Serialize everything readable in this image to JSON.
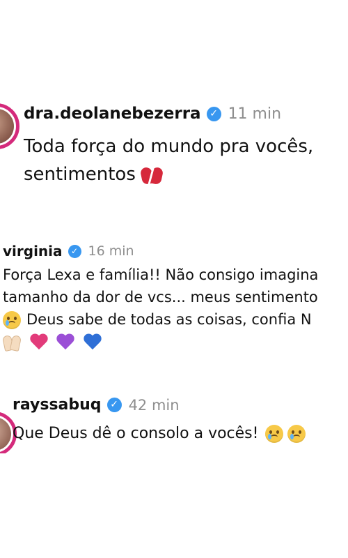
{
  "comments": [
    {
      "username": "dra.deolanebezerra",
      "time": "11 min",
      "line1": "Toda força do mundo pra vocês,",
      "line2": "sentimentos",
      "line2_emoji": [
        "broken-heart-icon"
      ]
    },
    {
      "username": "virginia",
      "time": "16 min",
      "line1": "Força Lexa e família!! Não consigo imagina",
      "line2": "tamanho da dor de vcs... meus sentimento",
      "line3": "Deus sabe de todas as coisas, confia N",
      "line3_emoji_lead": "crying-face-icon",
      "line4_emoji": [
        "raising-hands-icon",
        "sparkling-heart-icon",
        "purple-heart-icon",
        "blue-heart-icon"
      ]
    },
    {
      "username": "rayssabuq",
      "time": "42 min",
      "line1": "Que Deus dê o consolo a vocês!",
      "line1_emoji": [
        "crying-face-icon",
        "crying-face-icon"
      ]
    }
  ],
  "colors": {
    "story_ring": "#d42a7b",
    "verified_badge": "#3897f0",
    "timestamp": "#8e8e8e",
    "text": "#111111"
  }
}
